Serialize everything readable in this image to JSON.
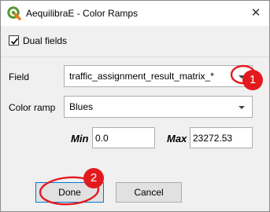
{
  "window": {
    "title": "AequilibraE - Color Ramps",
    "close_glyph": "✕"
  },
  "dual_fields": {
    "label": "Dual fields",
    "checked": true
  },
  "field": {
    "label": "Field",
    "value": "traffic_assignment_result_matrix_*"
  },
  "color_ramp": {
    "label": "Color ramp",
    "value": "Blues"
  },
  "range": {
    "min_label": "Min",
    "min_value": "0.0",
    "max_label": "Max",
    "max_value": "23272.53"
  },
  "buttons": {
    "done": "Done",
    "cancel": "Cancel"
  },
  "annotations": {
    "step1": "1",
    "step2": "2",
    "color": "#e3191e"
  },
  "icons": {
    "app": "qgis-icon",
    "close": "close-icon",
    "checkmark": "checkmark-icon",
    "dropdown": "chevron-down-icon"
  }
}
